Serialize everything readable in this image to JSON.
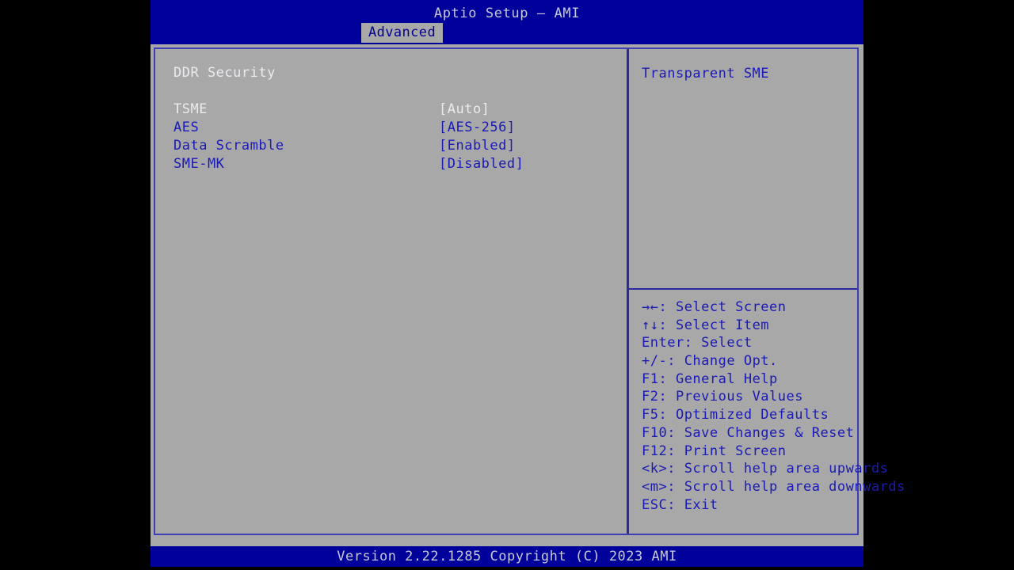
{
  "header": {
    "title": "Aptio Setup – AMI",
    "active_tab": "Advanced",
    "tabs": [
      "Advanced"
    ]
  },
  "main": {
    "section_heading": "DDR Security",
    "settings": [
      {
        "label": "TSME",
        "value": "[Auto]",
        "selected": true
      },
      {
        "label": "AES",
        "value": "[AES-256]",
        "selected": false
      },
      {
        "label": "Data Scramble",
        "value": "[Enabled]",
        "selected": false
      },
      {
        "label": "SME-MK",
        "value": "[Disabled]",
        "selected": false
      }
    ]
  },
  "help": {
    "description": "Transparent SME",
    "legend": [
      {
        "key": "→←:",
        "action": " Select Screen"
      },
      {
        "key": "↑↓:",
        "action": " Select Item"
      },
      {
        "key": "Enter:",
        "action": " Select"
      },
      {
        "key": "+/-:",
        "action": " Change Opt."
      },
      {
        "key": "F1:",
        "action": " General Help"
      },
      {
        "key": "F2:",
        "action": " Previous Values"
      },
      {
        "key": "F5:",
        "action": " Optimized Defaults"
      },
      {
        "key": "F10:",
        "action": " Save Changes & Reset"
      },
      {
        "key": "F12:",
        "action": " Print Screen"
      },
      {
        "key": "<k>:",
        "action": " Scroll help area upwards"
      },
      {
        "key": "<m>:",
        "action": " Scroll help area downwards"
      },
      {
        "key": "ESC:",
        "action": " Exit"
      }
    ]
  },
  "footer": {
    "version_text": "Version 2.22.1285 Copyright (C) 2023 AMI"
  },
  "colors": {
    "header_blue": "#00009b",
    "panel_gray": "#a8a8a8",
    "text_blue": "#1a1ab4",
    "text_white": "#ebebf0",
    "border_blue": "#3d3db4"
  }
}
